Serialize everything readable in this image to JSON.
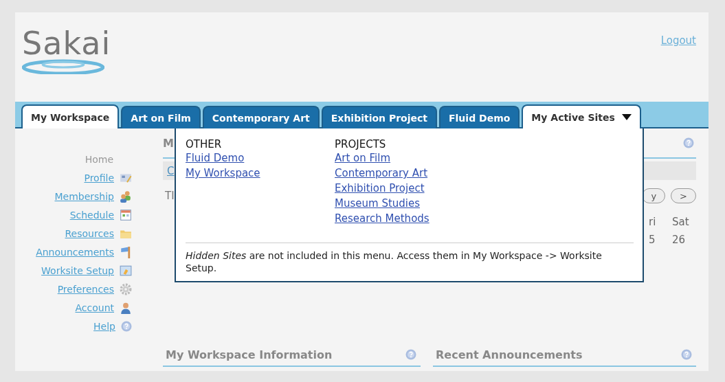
{
  "header": {
    "logo": "Sakai",
    "logout": "Logout"
  },
  "tabs": [
    {
      "label": "My Workspace",
      "kind": "site",
      "selected": true
    },
    {
      "label": "Art on Film",
      "kind": "site",
      "selected": false
    },
    {
      "label": "Contemporary Art",
      "kind": "site",
      "selected": false
    },
    {
      "label": "Exhibition Project",
      "kind": "site",
      "selected": false
    },
    {
      "label": "Fluid Demo",
      "kind": "site",
      "selected": false
    },
    {
      "label": "My Active Sites",
      "kind": "menu",
      "expanded": true
    }
  ],
  "sidebar": {
    "items": [
      {
        "label": "Home",
        "selected": true
      },
      {
        "label": "Profile",
        "selected": false
      },
      {
        "label": "Membership",
        "selected": false
      },
      {
        "label": "Schedule",
        "selected": false
      },
      {
        "label": "Resources",
        "selected": false
      },
      {
        "label": "Announcements",
        "selected": false
      },
      {
        "label": "Worksite Setup",
        "selected": false
      },
      {
        "label": "Preferences",
        "selected": false
      },
      {
        "label": "Account",
        "selected": false
      },
      {
        "label": "Help",
        "selected": false
      }
    ]
  },
  "portlet": {
    "title": "M",
    "link": "C",
    "text": "TI",
    "buttons": [
      "y",
      ">"
    ],
    "day_headers": [
      "ri",
      "Sat"
    ],
    "days": [
      "5",
      "26"
    ]
  },
  "menu": {
    "columns": [
      {
        "heading": "OTHER",
        "links": [
          "Fluid Demo",
          "My Workspace"
        ]
      },
      {
        "heading": "PROJECTS",
        "links": [
          "Art on Film",
          "Contemporary Art",
          "Exhibition Project",
          "Museum Studies",
          "Research Methods"
        ]
      }
    ],
    "note": "*Hidden Sites* are not included in this menu. Access them in My Workspace -> Worksite Setup."
  },
  "bottom_portlets": [
    {
      "title": "My Workspace Information"
    },
    {
      "title": "Recent Announcements"
    }
  ]
}
